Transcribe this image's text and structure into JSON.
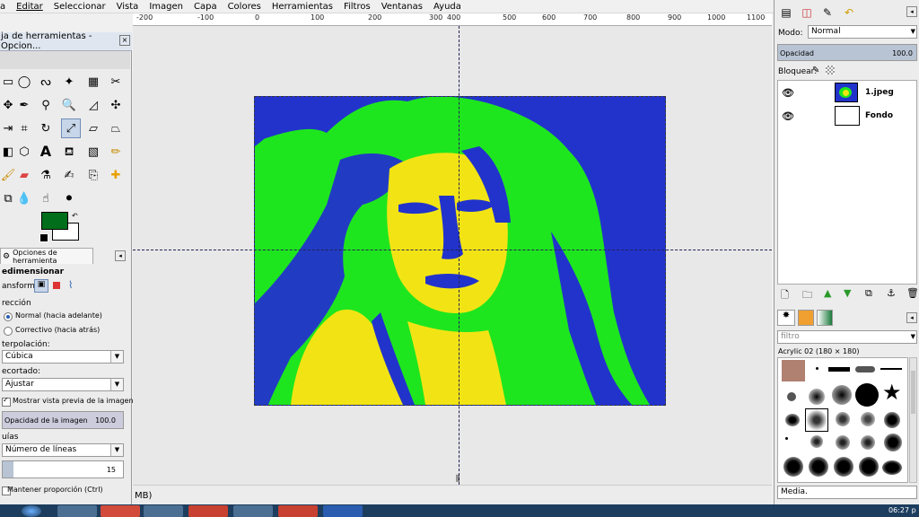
{
  "menubar": {
    "items": [
      "a",
      "Editar",
      "Seleccionar",
      "Vista",
      "Imagen",
      "Capa",
      "Colores",
      "Herramientas",
      "Filtros",
      "Ventanas",
      "Ayuda"
    ]
  },
  "ruler": {
    "ticks": [
      "-200",
      "-100",
      "0",
      "100",
      "200",
      "300",
      "400",
      "500",
      "600",
      "700",
      "800",
      "900",
      "1000",
      "1100"
    ]
  },
  "toolbox": {
    "title": "ja de herramientas - Opcion...",
    "tab_label": "Opciones de herramienta",
    "tool_name": "edimensionar",
    "transform_label": "ansformar:",
    "direction_label": "rección",
    "direction_options": [
      "Normal (hacia adelante)",
      "Correctivo (hacia atrás)"
    ],
    "interpolation_label": "terpolación:",
    "interpolation_value": "Cúbica",
    "clipping_label": "ecortado:",
    "clipping_value": "Ajustar",
    "preview_label": "Mostrar vista previa de la imagen",
    "opacity_label": "Opacidad de la imagen",
    "opacity_value": "100.0",
    "guides_label": "uías",
    "guides_value": "Número de líneas",
    "lines_value": "15",
    "keep_ratio_label": "Mantener proporción  (Ctrl)",
    "fg_color": "#006e1a",
    "bg_color": "#ffffff"
  },
  "statusbar": {
    "text": "MB)"
  },
  "layers": {
    "mode_label": "Modo:",
    "mode_value": "Normal",
    "opacity_label": "Opacidad",
    "opacity_value": "100.0",
    "lock_label": "Bloquear:",
    "items": [
      {
        "name": "1.jpeg"
      },
      {
        "name": "Fondo"
      }
    ]
  },
  "brushes": {
    "filter_placeholder": "filtro",
    "current_brush": "Acrylic 02 (180 × 180)",
    "footer_label": "Media."
  },
  "taskbar": {
    "clock": "06:27 p"
  },
  "colors": {
    "image_blue": "#2233cc",
    "image_green": "#1ee61e",
    "image_yellow": "#f2e414"
  }
}
